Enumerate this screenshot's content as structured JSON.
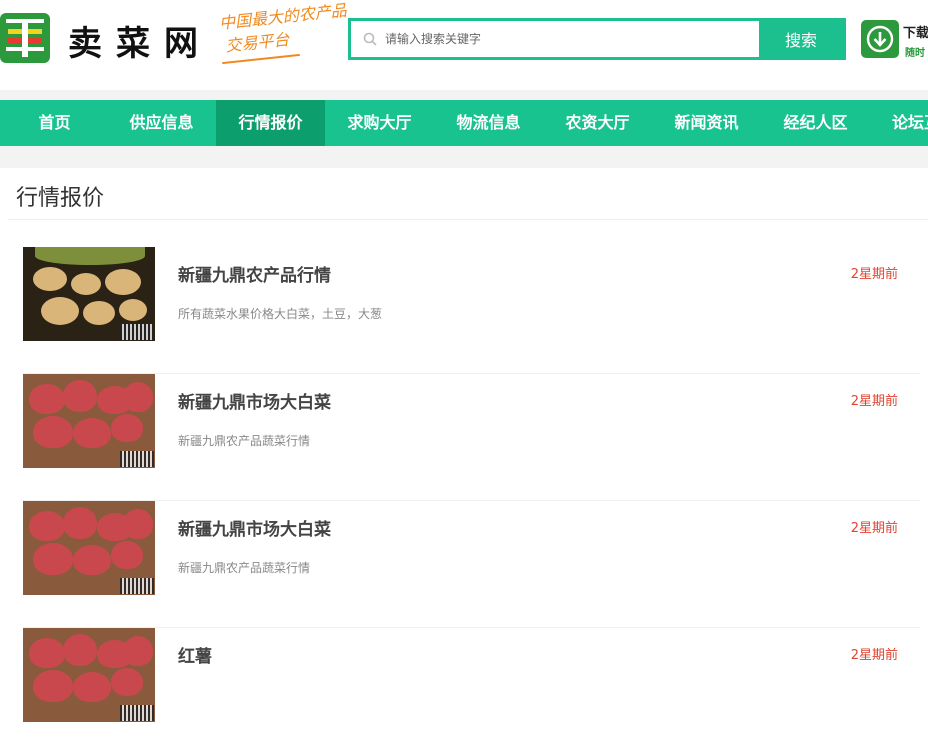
{
  "header": {
    "logo_text": "卖菜网",
    "slogan_line1": "中国最大的农产品",
    "slogan_line2": "交易平台",
    "search_placeholder": "请输入搜索关键字",
    "search_button": "搜索",
    "app_label": "下载",
    "app_sub": "随时"
  },
  "nav": {
    "items": [
      "首页",
      "供应信息",
      "行情报价",
      "求购大厅",
      "物流信息",
      "农资大厅",
      "新闻资讯",
      "经纪人区",
      "论坛互"
    ],
    "active_index": 2
  },
  "page": {
    "title": "行情报价"
  },
  "items": [
    {
      "title": "新疆九鼎农产品行情",
      "desc": "所有蔬菜水果价格大白菜，土豆，大葱",
      "time": "2星期前",
      "image": "potato"
    },
    {
      "title": "新疆九鼎市场大白菜",
      "desc": "新疆九鼎农产品蔬菜行情",
      "time": "2星期前",
      "image": "yam"
    },
    {
      "title": "新疆九鼎市场大白菜",
      "desc": "新疆九鼎农产品蔬菜行情",
      "time": "2星期前",
      "image": "yam"
    },
    {
      "title": "红薯",
      "desc": "",
      "time": "2星期前",
      "image": "yam"
    }
  ],
  "colors": {
    "brand_green": "#19c38f",
    "nav_active": "#0d9e6e",
    "time_red": "#e0432f",
    "slogan_orange": "#f08a1e"
  }
}
